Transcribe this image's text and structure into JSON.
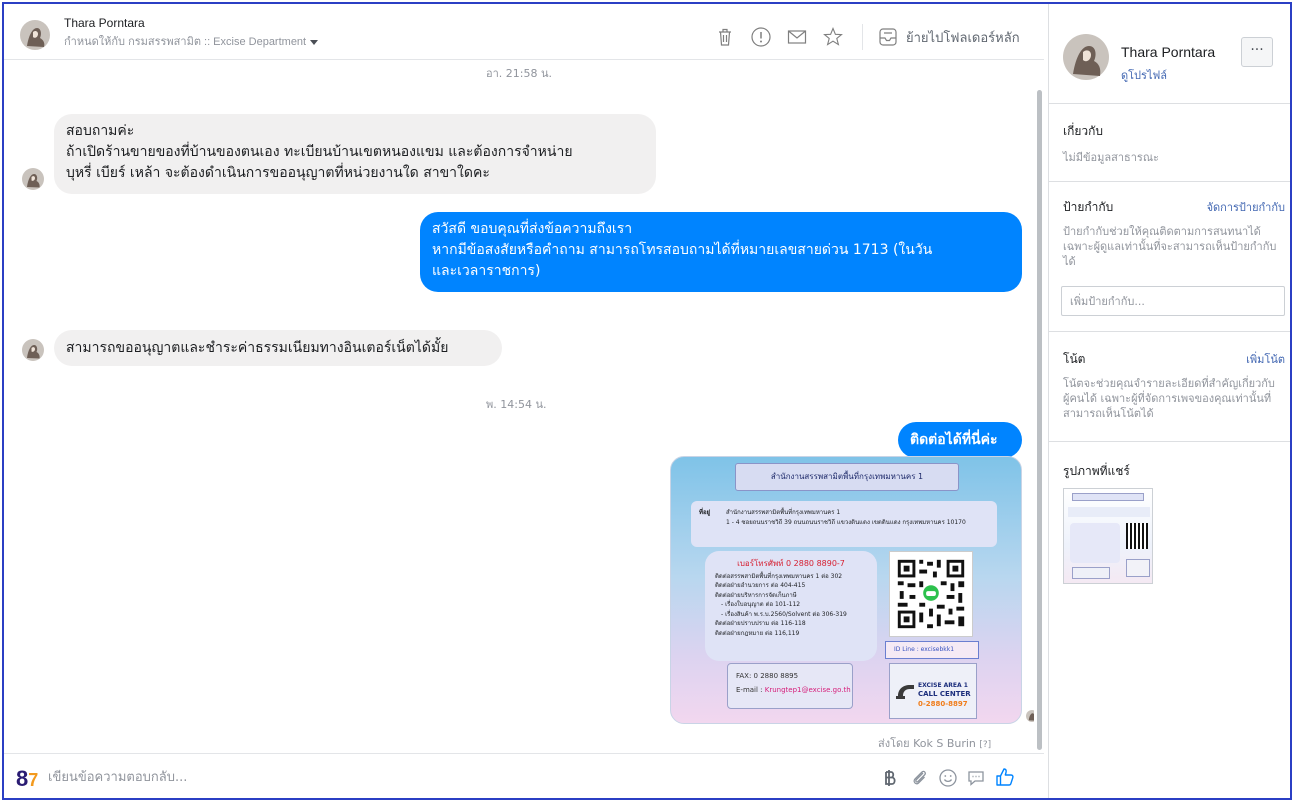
{
  "header": {
    "contact_name": "Thara Porntara",
    "assigned_to": "กำหนดให้กับ กรมสรรพสามิต :: Excise Department",
    "move_to_main": "ย้ายไปโฟลเดอร์หลัก",
    "icons": [
      "trash-icon",
      "alert-icon",
      "envelope-icon",
      "star-icon",
      "inbox-icon"
    ]
  },
  "conversation": {
    "timestamp_top": "อา. 21:58 น.",
    "msg1": {
      "lines": [
        "สอบถามค่ะ",
        "ถ้าเปิดร้านขายของที่บ้านของตนเอง ทะเบียนบ้านเขตหนองแขม และต้องการจำหน่าย",
        "บุหรี่ เบียร์ เหล้า จะต้องดำเนินการขออนุญาตที่หน่วยงานใด สาขาใดคะ"
      ]
    },
    "reply1": {
      "lines": [
        "สวัสดี ขอบคุณที่ส่งข้อความถึงเรา",
        "หากมีข้อสงสัยหรือคำถาม สามารถโทรสอบถามได้ที่หมายเลขสายด่วน 1713 (ในวัน",
        "และเวลาราชการ)"
      ]
    },
    "msg2": "สามารถขออนุญาตและชำระค่าธรรมเนียมทางอินเตอร์เน็ตได้มั้ย",
    "timestamp_mid": "พ. 14:54 น.",
    "reply2": "ติดต่อได้ที่นี่ค่ะ",
    "shared_image": {
      "title": "สำนักงานสรรพสามิตพื้นที่กรุงเทพมหานคร 1",
      "address_label": "ที่อยู่",
      "address_1": "สำนักงานสรรพสามิตพื้นที่กรุงเทพมหานคร 1",
      "address_2": "1 - 4 ซอยถนนราชวิถี 39 ถนนถนนราชวิถี แขวงดินแดง เขตดินแดง กรุงเทพมหานคร 10170",
      "phone_header": "เบอร์โทรศัพท์ 0 2880 8890-7",
      "phone_lines": [
        "ติดต่อสรรพสามิตพื้นที่กรุงเทพมหานคร 1 ต่อ 302",
        "ติดต่อฝ่ายอำนวยการ ต่อ 404-415",
        "ติดต่อฝ่ายบริหารการจัดเก็บภาษี",
        "- เรื่องใบอนุญาต ต่อ 101-112",
        "- เรื่องสินค้า พ.ร.บ.2560/Solvent ต่อ 306-319",
        "ติดต่อฝ่ายปราบปราม ต่อ 116-118",
        "ติดต่อฝ่ายกฎหมาย ต่อ 116,119"
      ],
      "line_id": "ID Line : excisebkk1",
      "fax": "FAX: 0 2880 8895",
      "email_label": "E-mail :",
      "email": "Krungtep1@excise.go.th",
      "call_1": "EXCISE AREA 1",
      "call_2": "CALL CENTER",
      "call_3": "0-2880-8897"
    },
    "sent_by": "ส่งโดย Kok S Burin",
    "sent_by_help": "[?]"
  },
  "composer": {
    "logo": "8",
    "placeholder": "เขียนข้อความตอบกลับ...",
    "icons": [
      "baht-icon",
      "attachment-icon",
      "emoji-icon",
      "saved-reply-icon",
      "like-icon"
    ]
  },
  "right_panel": {
    "name": "Thara Porntara",
    "view_profile": "ดูโปรไฟล์",
    "more": "···",
    "about_title": "เกี่ยวกับ",
    "about_text": "ไม่มีข้อมูลสาธารณะ",
    "labels_title": "ป้ายกำกับ",
    "labels_manage": "จัดการป้ายกำกับ",
    "labels_text": "ป้ายกำกับช่วยให้คุณติดตามการสนทนาได้ เฉพาะผู้ดูแลเท่านั้นที่จะสามารถเห็นป้ายกำกับได้",
    "labels_placeholder": "เพิ่มป้ายกำกับ...",
    "notes_title": "โน้ต",
    "notes_add": "เพิ่มโน้ต",
    "notes_text": "โน้ตจะช่วยคุณจำรายละเอียดที่สำคัญเกี่ยวกับผู้คนได้ เฉพาะผู้ที่จัดการเพจของคุณเท่านั้นที่สามารถเห็นโน้ตได้",
    "shared_photos_title": "รูปภาพที่แชร์"
  },
  "colors": {
    "accent": "#0084ff",
    "link": "#4267b2",
    "incoming_bubble": "#f1f0f0",
    "frame": "#2b3fc4"
  }
}
